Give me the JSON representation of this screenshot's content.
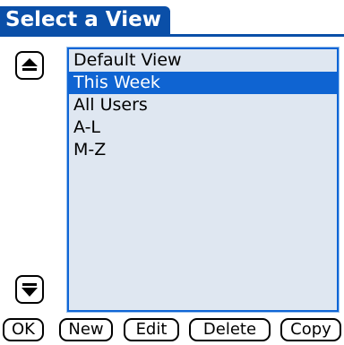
{
  "title": "Select a View",
  "list": {
    "items": [
      {
        "label": "Default View",
        "selected": false
      },
      {
        "label": "This Week",
        "selected": true
      },
      {
        "label": "All Users",
        "selected": false
      },
      {
        "label": "A-L",
        "selected": false
      },
      {
        "label": "M-Z",
        "selected": false
      }
    ]
  },
  "scroll": {
    "up_icon": "arrow-up-icon",
    "down_icon": "arrow-down-icon"
  },
  "buttons": {
    "ok": "OK",
    "new": "New",
    "edit": "Edit",
    "delete": "Delete",
    "copy": "Copy"
  },
  "colors": {
    "title_bg": "#0a4fa8",
    "selection_bg": "#0f64d2",
    "list_bg": "#dfe7f1",
    "list_border": "#0f65d6"
  }
}
